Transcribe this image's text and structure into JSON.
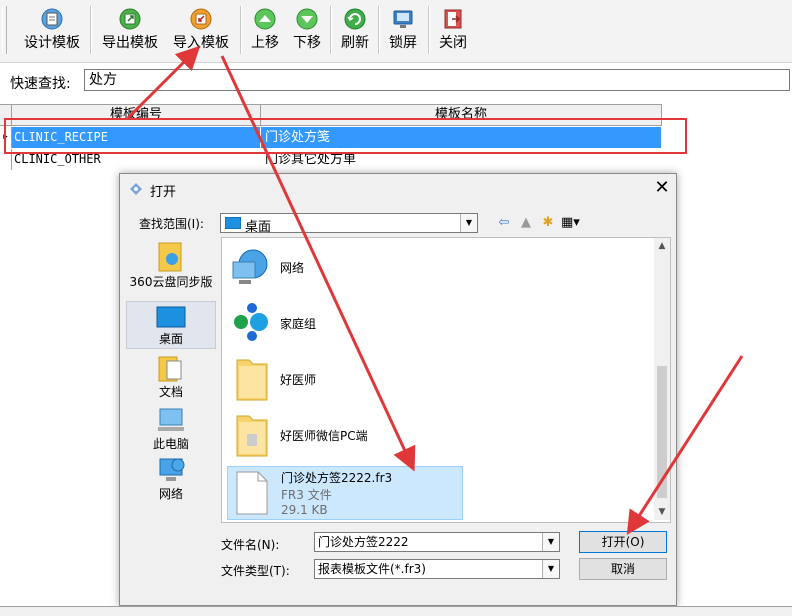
{
  "toolbar": {
    "buttons": [
      {
        "label": "设计模板",
        "icon": "design-template-icon"
      },
      {
        "label": "导出模板",
        "icon": "export-template-icon"
      },
      {
        "label": "导入模板",
        "icon": "import-template-icon"
      },
      {
        "label": "上移",
        "icon": "move-up-icon"
      },
      {
        "label": "下移",
        "icon": "move-down-icon"
      },
      {
        "label": "刷新",
        "icon": "refresh-icon"
      },
      {
        "label": "锁屏",
        "icon": "lock-screen-icon"
      },
      {
        "label": "关闭",
        "icon": "close-exit-icon"
      }
    ]
  },
  "search": {
    "label": "快速查找:",
    "value": "处方"
  },
  "grid": {
    "columns": [
      "模板编号",
      "模板名称"
    ],
    "rows": [
      {
        "code": "CLINIC_RECIPE",
        "name": "门诊处方笺",
        "selected": true
      },
      {
        "code": "CLINIC_OTHER",
        "name": "门诊其它处方单",
        "selected": false
      }
    ]
  },
  "dialog": {
    "title": "打开",
    "look_in_label": "查找范围(I):",
    "look_in_value": "桌面",
    "places": [
      {
        "label": "360云盘同步版",
        "icon": "cloud-folder-icon"
      },
      {
        "label": "桌面",
        "icon": "desktop-icon",
        "selected": true
      },
      {
        "label": "文档",
        "icon": "documents-icon"
      },
      {
        "label": "此电脑",
        "icon": "computer-icon"
      },
      {
        "label": "网络",
        "icon": "network-icon"
      }
    ],
    "files": [
      {
        "name": "网络",
        "icon": "network-icon"
      },
      {
        "name": "家庭组",
        "icon": "homegroup-icon"
      },
      {
        "name": "好医师",
        "icon": "folder-icon"
      },
      {
        "name": "好医师微信PC端",
        "icon": "folder-icon"
      },
      {
        "name": "门诊处方签2222.fr3",
        "icon": "file-icon",
        "type": "FR3 文件",
        "size": "29.1 KB",
        "selected": true
      }
    ],
    "filename_label": "文件名(N):",
    "filename_value": "门诊处方签2222",
    "filetype_label": "文件类型(T):",
    "filetype_value": "报表模板文件(*.fr3)",
    "open_button": "打开(O)",
    "cancel_button": "取消"
  },
  "colors": {
    "selection": "#3399ff",
    "annotation": "#e0383a",
    "file_selection": "#cce8ff"
  }
}
